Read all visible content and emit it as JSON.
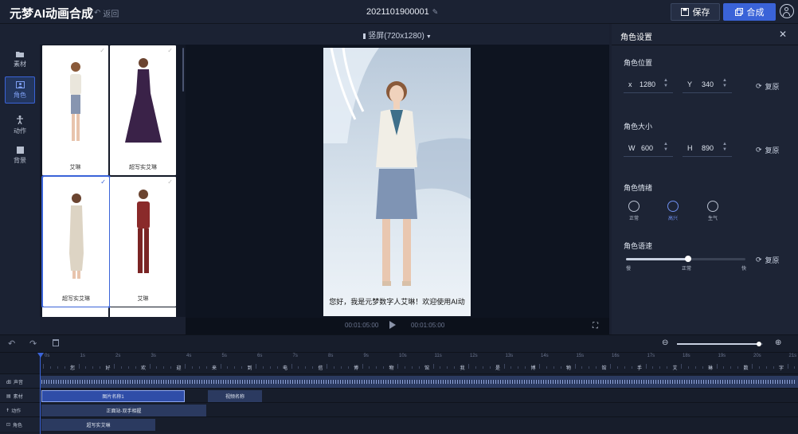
{
  "header": {
    "app_title": "元梦AI动画合成",
    "back_label": "返回",
    "doc_title": "2021101900001",
    "save_label": "保存",
    "compose_label": "合成"
  },
  "sidebar": {
    "items": [
      {
        "label": "素材",
        "icon": "folder-icon"
      },
      {
        "label": "角色",
        "icon": "character-icon",
        "active": true
      },
      {
        "label": "动作",
        "icon": "person-icon"
      },
      {
        "label": "背景",
        "icon": "background-icon"
      }
    ]
  },
  "materials": [
    {
      "label": "艾琳",
      "selected": false
    },
    {
      "label": "超写实艾琳",
      "selected": false
    },
    {
      "label": "超写实艾琳",
      "selected": true
    },
    {
      "label": "艾琳",
      "selected": false
    }
  ],
  "preview": {
    "orientation": "竖屏(720x1280)",
    "subtitle": "您好，我是元梦数字人艾琳！欢迎使用AI动",
    "time_current": "00:01:05:00",
    "time_total": "00:01:05:00"
  },
  "settings": {
    "title": "角色设置",
    "position": {
      "title": "角色位置",
      "x_label": "x",
      "x": "1280",
      "y_label": "Y",
      "y": "340"
    },
    "size": {
      "title": "角色大小",
      "w_label": "W",
      "w": "600",
      "h_label": "H",
      "h": "890"
    },
    "emotion": {
      "title": "角色情绪",
      "options": [
        "正常",
        "高兴",
        "生气"
      ],
      "selected": 1
    },
    "speed": {
      "title": "角色语速",
      "slow": "慢",
      "normal": "正常",
      "fast": "快",
      "value": 0.52
    },
    "reset_label": "复原"
  },
  "timeline": {
    "zoom": 0.95,
    "ruler_labels": [
      "0s",
      "1s",
      "2s",
      "3s",
      "4s",
      "5s",
      "6s",
      "7s",
      "8s",
      "9s",
      "10s",
      "11s",
      "12s",
      "13s",
      "14s",
      "15s",
      "16s",
      "17s",
      "18s",
      "19s",
      "20s",
      "21s"
    ],
    "characters": [
      "您",
      "好",
      "欢",
      "迎",
      "来",
      "到",
      "电",
      "信",
      "博",
      "物",
      "馆",
      "我",
      "是",
      "博",
      "物",
      "馆",
      "手",
      "艾",
      "琳",
      "数",
      "字"
    ],
    "tracks": [
      {
        "label": "声音",
        "icon": "audio-icon"
      },
      {
        "label": "素材",
        "icon": "image-icon"
      },
      {
        "label": "动作",
        "icon": "person-icon"
      },
      {
        "label": "角色",
        "icon": "character-icon"
      }
    ],
    "clips": {
      "material": [
        {
          "label": "图片名称1"
        },
        {
          "label": "视频名称"
        }
      ],
      "action": [
        {
          "label": "正面站-双手相握"
        }
      ],
      "role": [
        {
          "label": "超写实艾琳"
        }
      ]
    }
  },
  "colors": {
    "accent": "#3a63d8",
    "panel": "#1d2435",
    "bg": "#0e1420"
  }
}
